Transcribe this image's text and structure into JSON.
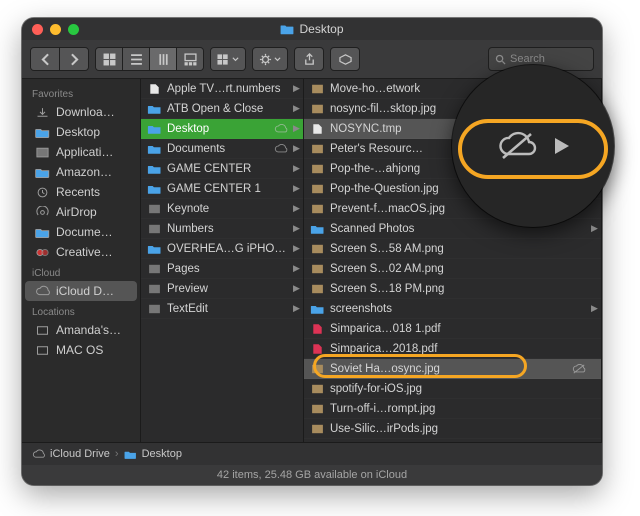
{
  "window": {
    "title": "Desktop"
  },
  "search": {
    "placeholder": "Search"
  },
  "sidebar": {
    "sections": [
      {
        "header": "Favorites",
        "items": [
          {
            "icon": "download",
            "label": "Downloa…"
          },
          {
            "icon": "folder",
            "label": "Desktop"
          },
          {
            "icon": "app",
            "label": "Applicati…"
          },
          {
            "icon": "folder",
            "label": "Amazon…"
          },
          {
            "icon": "clock",
            "label": "Recents"
          },
          {
            "icon": "airdrop",
            "label": "AirDrop"
          },
          {
            "icon": "folder",
            "label": "Docume…"
          },
          {
            "icon": "cc",
            "label": "Creative…"
          }
        ]
      },
      {
        "header": "iCloud",
        "items": [
          {
            "icon": "cloud",
            "label": "iCloud D…",
            "selected": true
          }
        ]
      },
      {
        "header": "Locations",
        "items": [
          {
            "icon": "disk",
            "label": "Amanda's…"
          },
          {
            "icon": "disk",
            "label": "MAC OS"
          }
        ]
      }
    ]
  },
  "col1": [
    {
      "icon": "doc",
      "label": "Apple TV…rt.numbers",
      "chev": true
    },
    {
      "icon": "folder",
      "label": "ATB Open & Close",
      "chev": true
    },
    {
      "icon": "folder",
      "label": "Desktop",
      "chev": true,
      "cloud": true,
      "selected": true
    },
    {
      "icon": "folder",
      "label": "Documents",
      "chev": true,
      "cloud": true
    },
    {
      "icon": "folder",
      "label": "GAME CENTER",
      "chev": true
    },
    {
      "icon": "folder",
      "label": "GAME CENTER 1",
      "chev": true
    },
    {
      "icon": "app",
      "label": "Keynote",
      "chev": true
    },
    {
      "icon": "app",
      "label": "Numbers",
      "chev": true
    },
    {
      "icon": "folder",
      "label": "OVERHEA…G iPHONE",
      "chev": true
    },
    {
      "icon": "app",
      "label": "Pages",
      "chev": true
    },
    {
      "icon": "app",
      "label": "Preview",
      "chev": true
    },
    {
      "icon": "app",
      "label": "TextEdit",
      "chev": true
    }
  ],
  "col2": [
    {
      "icon": "img",
      "label": "Move-ho…etwork"
    },
    {
      "icon": "img",
      "label": "nosync-fil…sktop.jpg"
    },
    {
      "icon": "doc",
      "label": "NOSYNC.tmp",
      "sel2": true
    },
    {
      "icon": "img",
      "label": "Peter's Resourc…",
      "chev": true
    },
    {
      "icon": "img",
      "label": "Pop-the-…ahjong"
    },
    {
      "icon": "img",
      "label": "Pop-the-Question.jpg"
    },
    {
      "icon": "img",
      "label": "Prevent-f…macOS.jpg"
    },
    {
      "icon": "folder",
      "label": "Scanned Photos",
      "chev": true
    },
    {
      "icon": "img",
      "label": "Screen S…58 AM.png"
    },
    {
      "icon": "img",
      "label": "Screen S…02 AM.png"
    },
    {
      "icon": "img",
      "label": "Screen S…18 PM.png"
    },
    {
      "icon": "folder",
      "label": "screenshots",
      "chev": true
    },
    {
      "icon": "pdf",
      "label": "Simparica…018 1.pdf"
    },
    {
      "icon": "pdf",
      "label": "Simparica…2018.pdf"
    },
    {
      "icon": "img",
      "label": "Soviet Ha…osync.jpg",
      "sel2": true,
      "nosync": true
    },
    {
      "icon": "img",
      "label": "spotify-for-iOS.jpg"
    },
    {
      "icon": "img",
      "label": "Turn-off-i…rompt.jpg"
    },
    {
      "icon": "img",
      "label": "Use-Silic…irPods.jpg"
    }
  ],
  "pathbar": [
    {
      "icon": "cloud",
      "label": "iCloud Drive"
    },
    {
      "icon": "folder",
      "label": "Desktop"
    }
  ],
  "status": "42 items, 25.48 GB available on iCloud"
}
